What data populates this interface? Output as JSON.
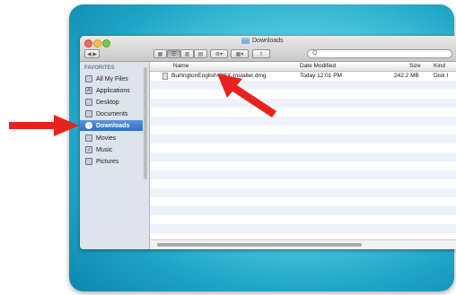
{
  "window": {
    "title": "Downloads"
  },
  "search": {
    "placeholder": "Q"
  },
  "sidebar": {
    "header": "FAVORITES",
    "items": [
      {
        "label": "All My Files",
        "icon": "all-files-icon",
        "glyph": ""
      },
      {
        "label": "Applications",
        "icon": "applications-icon",
        "glyph": "A"
      },
      {
        "label": "Desktop",
        "icon": "desktop-icon",
        "glyph": ""
      },
      {
        "label": "Documents",
        "icon": "documents-icon",
        "glyph": ""
      },
      {
        "label": "Downloads",
        "icon": "downloads-icon",
        "glyph": "↓"
      },
      {
        "label": "Movies",
        "icon": "movies-icon",
        "glyph": ""
      },
      {
        "label": "Music",
        "icon": "music-icon",
        "glyph": "♪"
      },
      {
        "label": "Pictures",
        "icon": "pictures-icon",
        "glyph": ""
      }
    ],
    "selected": "Downloads"
  },
  "list": {
    "columns": [
      "Name",
      "Date Modified",
      "Size",
      "Kind"
    ],
    "rows": [
      {
        "name": "BurlingtonEnglish-OSX-Installer.dmg",
        "date": "Today 12:01 PM",
        "size": "242.2 MB",
        "kind": "Disk I"
      }
    ]
  },
  "colors": {
    "backdrop": "#1fa6c7",
    "selection": "#2f6ec3",
    "arrow": "#e8231f"
  }
}
